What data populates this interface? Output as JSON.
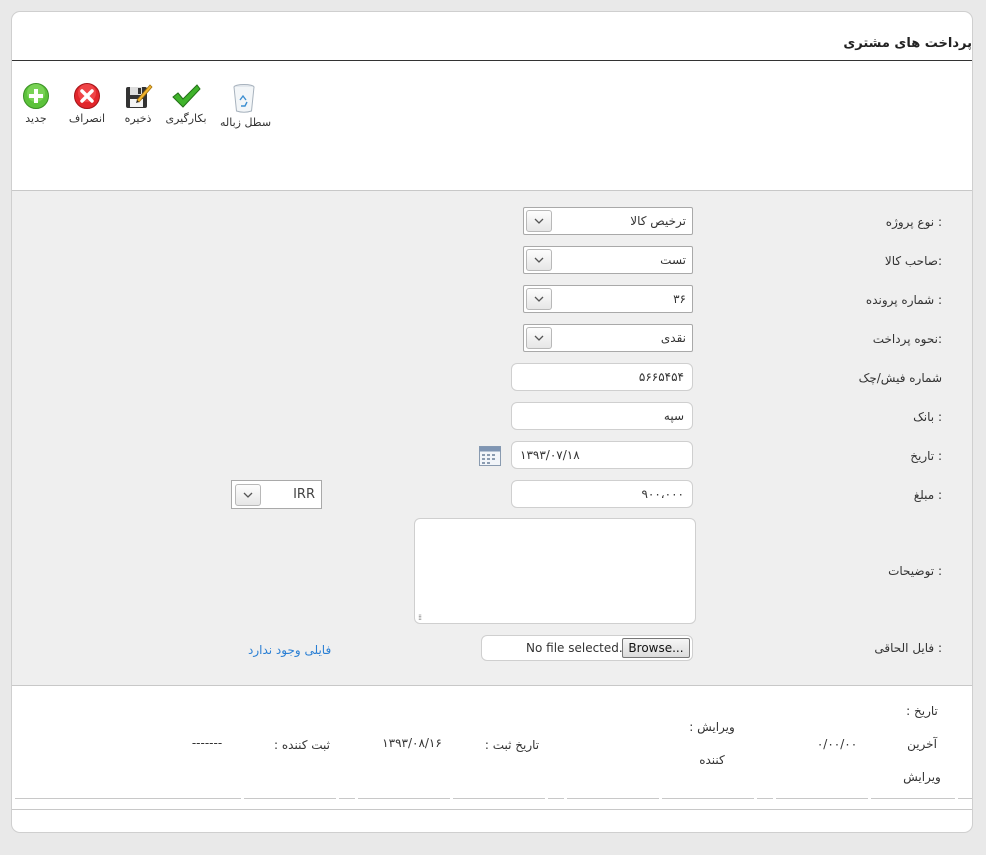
{
  "page": {
    "title": "پرداخت های مشتری"
  },
  "toolbar": {
    "new_label": "جدید",
    "cancel_label": "انصراف",
    "save_label": "ذخیره",
    "apply_label": "بکارگیری",
    "trash_label": "سطل زباله"
  },
  "form": {
    "project_type": {
      "label": "نوع پروژه :",
      "value": "ترخیص کالا"
    },
    "goods_owner": {
      "label": "صاحب کالا:",
      "value": "تست"
    },
    "file_number": {
      "label": "شماره پرونده :",
      "value": "۳۶"
    },
    "payment_method": {
      "label": "نحوه پرداخت:",
      "value": "نقدی"
    },
    "receipt_number": {
      "label": "شماره فیش/چک",
      "value": "۵۶۶۵۴۵۴"
    },
    "bank": {
      "label": "بانک :",
      "value": "سپه"
    },
    "date": {
      "label": "تاریخ :",
      "value": "۱۳۹۳/۰۷/۱۸"
    },
    "amount": {
      "label": "مبلغ :",
      "value": "۹۰۰،۰۰۰"
    },
    "currency": {
      "value": "IRR"
    },
    "description": {
      "label": "توضیحات :",
      "value": ""
    },
    "attachment": {
      "label": "فایل الحاقی :",
      "browse_label": "Browse...",
      "status": "No file selected.",
      "no_file_link": "فایلی وجود ندارد"
    }
  },
  "footer": {
    "last_edit_date_label_1": ": تاریخ",
    "last_edit_date_label_2": "آخرین",
    "last_edit_date_label_3": "ویرایش",
    "last_edit_date_value": "۰/۰۰/۰۰",
    "editor_label_1": ": ویرایش",
    "editor_label_2": "کننده",
    "register_date_label": ": تاریخ ثبت",
    "register_date_value": "۱۳۹۳/۰۸/۱۶",
    "registrar_label": ": ثبت کننده",
    "registrar_value": "-------"
  }
}
